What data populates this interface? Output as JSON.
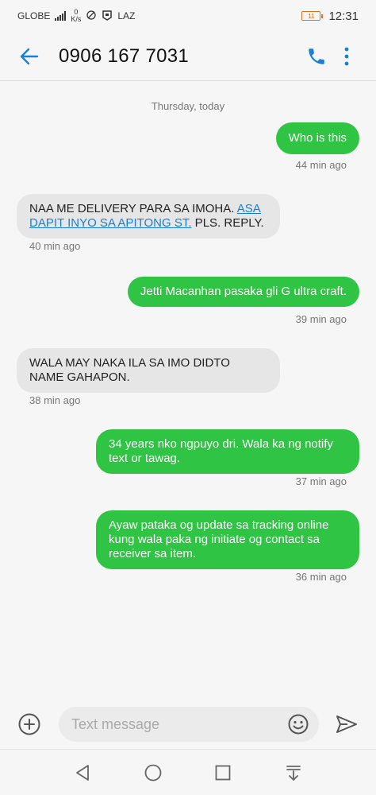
{
  "status_bar": {
    "carrier": "GLOBE",
    "net_speed_value": "0",
    "net_speed_unit": "K/s",
    "app_tag": "LAZ",
    "battery_label": "11",
    "time": "12:31"
  },
  "header": {
    "title": "0906 167 7031",
    "back_icon": "arrow-left-icon",
    "call_icon": "phone-icon",
    "menu_icon": "more-vertical-icon",
    "accent_color": "#1a7fd6"
  },
  "thread": {
    "date_separator": "Thursday, today",
    "messages": [
      {
        "direction": "outgoing",
        "text": "Who is this",
        "time": "44 min ago"
      },
      {
        "direction": "incoming",
        "text_before": "NAA ME DELIVERY PARA SA IMOHA. ",
        "link": "ASA DAPIT INYO SA APITONG ST.",
        "text_after": " PLS. REPLY.",
        "time": "40 min ago"
      },
      {
        "direction": "outgoing",
        "text": "Jetti Macanhan pasaka gli G ultra craft.",
        "time": "39 min ago"
      },
      {
        "direction": "incoming",
        "text": "WALA MAY NAKA ILA SA IMO DIDTO NAME GAHAPON.",
        "time": "38 min ago"
      },
      {
        "direction": "outgoing",
        "text": "34 years nko ngpuyo dri. Wala ka ng notify text or tawag.",
        "time": "37 min ago"
      },
      {
        "direction": "outgoing",
        "text": "Ayaw pataka og update sa tracking online kung wala paka ng initiate og contact sa receiver sa item.",
        "time": "36 min ago"
      }
    ],
    "outgoing_color": "#2fc443",
    "incoming_color": "#e6e6e6"
  },
  "composer": {
    "placeholder": "Text message",
    "value": "",
    "add_icon": "plus-circle-icon",
    "emoji_icon": "smiley-icon",
    "send_icon": "send-icon"
  },
  "nav": {
    "back_icon": "nav-back-icon",
    "home_icon": "nav-home-icon",
    "recents_icon": "nav-recents-icon",
    "notifications_icon": "nav-pulldown-icon"
  }
}
